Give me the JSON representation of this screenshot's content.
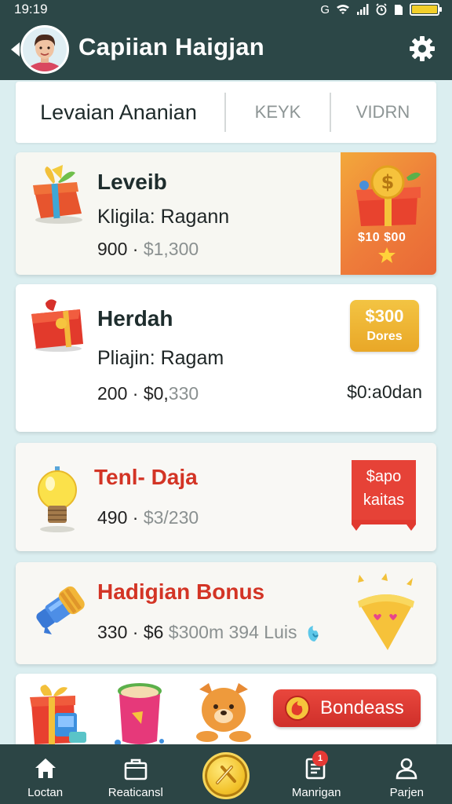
{
  "status_bar": {
    "time": "19:19",
    "icons": [
      "g-icon",
      "wifi-icon",
      "signal-icon",
      "alarm-icon",
      "sim-icon",
      "battery-icon"
    ],
    "battery_level": 0.95,
    "battery_color": "#f2cf2a"
  },
  "header": {
    "title": "Capiian Haigjan",
    "bg_color": "#2c4747"
  },
  "tabs": [
    {
      "label": "Levaian Ananian",
      "selected": true
    },
    {
      "label": "KEYK",
      "selected": false
    },
    {
      "label": "VIDRN",
      "selected": false
    }
  ],
  "cards": [
    {
      "title": "Leveib",
      "subtitle": "Kligila: Ragann",
      "price_main": "900 ·",
      "price_muted": " $1,300",
      "promo_text": "$10  $00"
    },
    {
      "title": "Herdah",
      "subtitle": "Pliajin: Ragam",
      "price_main": "200 · $0,",
      "price_muted": "330",
      "badge_line1": "$300",
      "badge_line2": "Dores",
      "right_amount": "$0:a0dan"
    },
    {
      "title": "Tenl- Daja",
      "price_main": "490 ·",
      "price_muted": " $3/230",
      "ribbon_line1": "$apo",
      "ribbon_line2": "kaitas"
    },
    {
      "title": "Hadigian Bonus",
      "price_main": "330 · $6",
      "price_muted": " $300m 394 Luis"
    },
    {
      "button_label": "Bondeass"
    }
  ],
  "bottom_nav": [
    {
      "label": "Loctan",
      "icon": "home-icon"
    },
    {
      "label": "Reaticansl",
      "icon": "bag-icon"
    },
    {
      "label": "",
      "icon": "coin-icon"
    },
    {
      "label": "Manrigan",
      "icon": "list-icon",
      "badge": "1"
    },
    {
      "label": "Parjen",
      "icon": "profile-icon"
    }
  ],
  "colors": {
    "accent_red": "#d33425",
    "accent_gold": "#f2c22b",
    "nav_bg": "#2c4545",
    "page_bg": "#dbeef0"
  }
}
